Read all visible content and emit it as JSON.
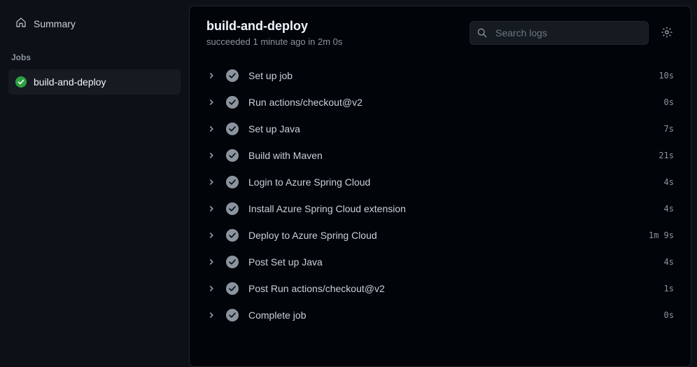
{
  "sidebar": {
    "summary_label": "Summary",
    "jobs_header": "Jobs",
    "job_name": "build-and-deploy"
  },
  "main": {
    "title": "build-and-deploy",
    "subtitle": "succeeded 1 minute ago in 2m 0s",
    "search_placeholder": "Search logs"
  },
  "steps": [
    {
      "name": "Set up job",
      "duration": "10s"
    },
    {
      "name": "Run actions/checkout@v2",
      "duration": "0s"
    },
    {
      "name": "Set up Java",
      "duration": "7s"
    },
    {
      "name": "Build with Maven",
      "duration": "21s"
    },
    {
      "name": "Login to Azure Spring Cloud",
      "duration": "4s"
    },
    {
      "name": "Install Azure Spring Cloud extension",
      "duration": "4s"
    },
    {
      "name": "Deploy to Azure Spring Cloud",
      "duration": "1m 9s"
    },
    {
      "name": "Post Set up Java",
      "duration": "4s"
    },
    {
      "name": "Post Run actions/checkout@v2",
      "duration": "1s"
    },
    {
      "name": "Complete job",
      "duration": "0s"
    }
  ]
}
